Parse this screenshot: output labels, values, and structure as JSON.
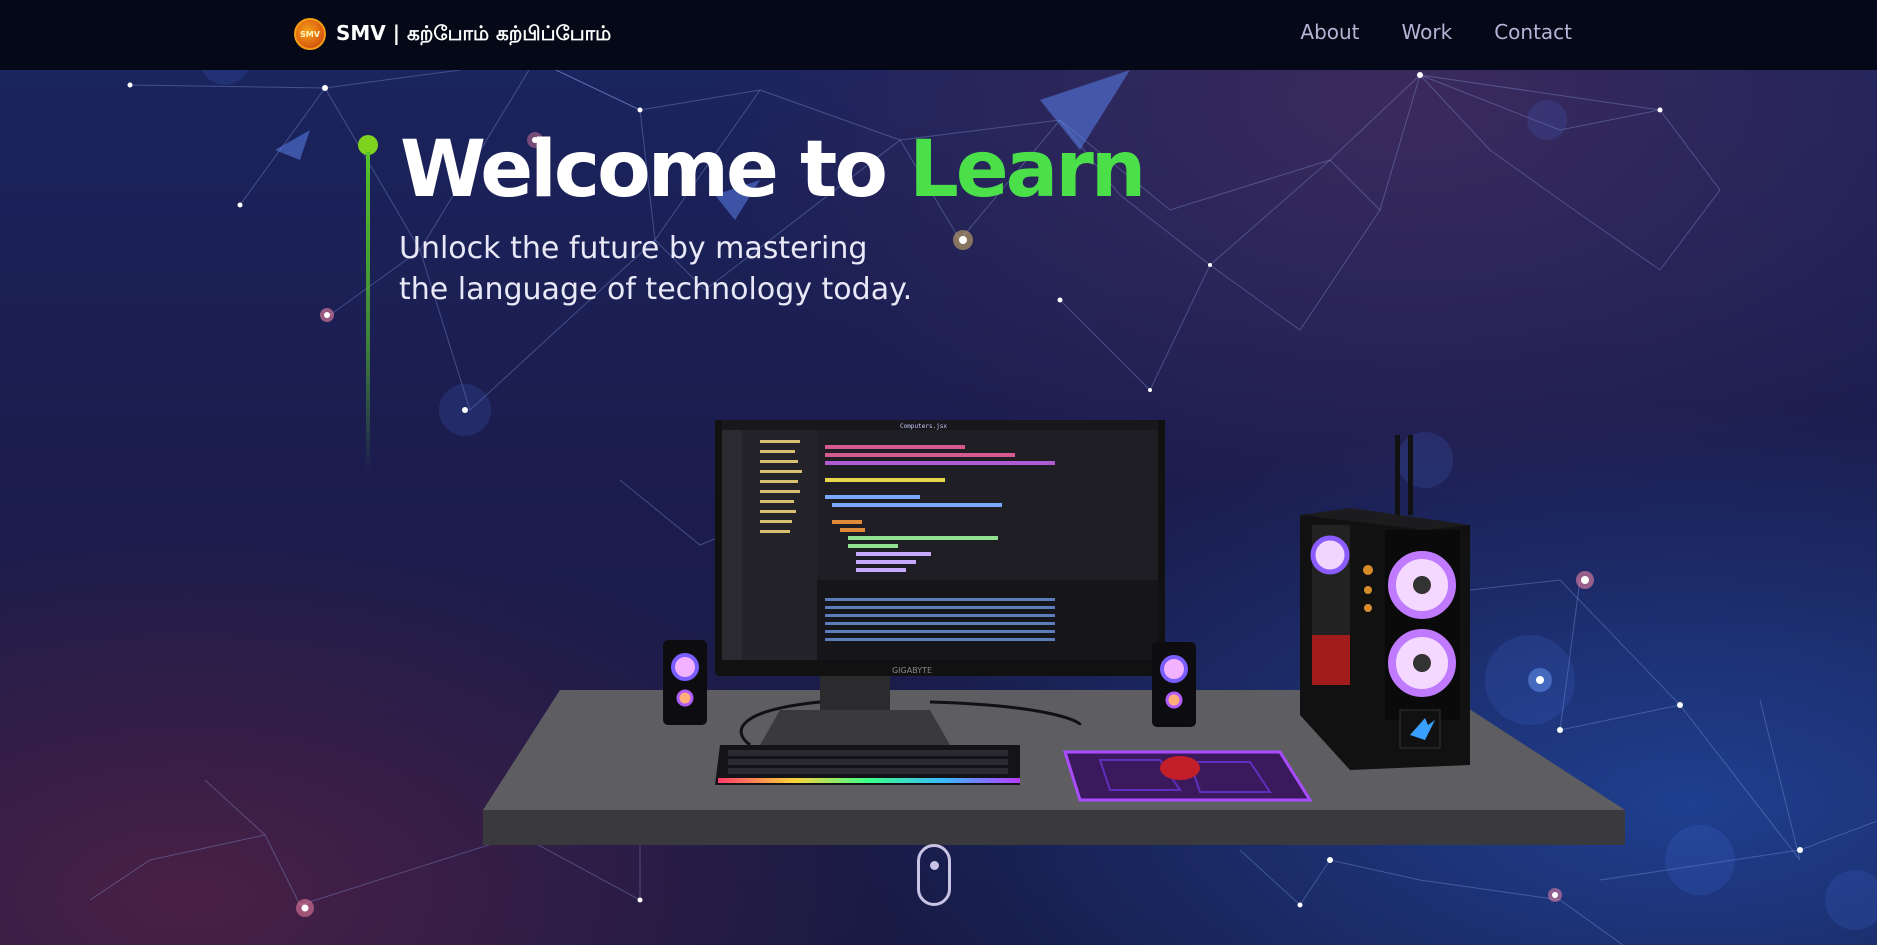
{
  "header": {
    "logo_text": "SMV",
    "brand_name": "SMV | கற்போம் கற்பிப்போம்",
    "nav": [
      {
        "label": "About"
      },
      {
        "label": "Work"
      },
      {
        "label": "Contact"
      }
    ]
  },
  "hero": {
    "title_part1": "Welcome to",
    "title_part2": "Learn",
    "subtitle_line1": "Unlock the future by mastering",
    "subtitle_line2": "the language of technology today.",
    "accent_color": "#4be04a"
  },
  "scene": {
    "monitor_brand": "GIGABYTE",
    "editor_tab": "Computers.jsx"
  },
  "icons": {
    "logo": "smv-logo-icon",
    "scroll": "scroll-mouse-icon"
  }
}
